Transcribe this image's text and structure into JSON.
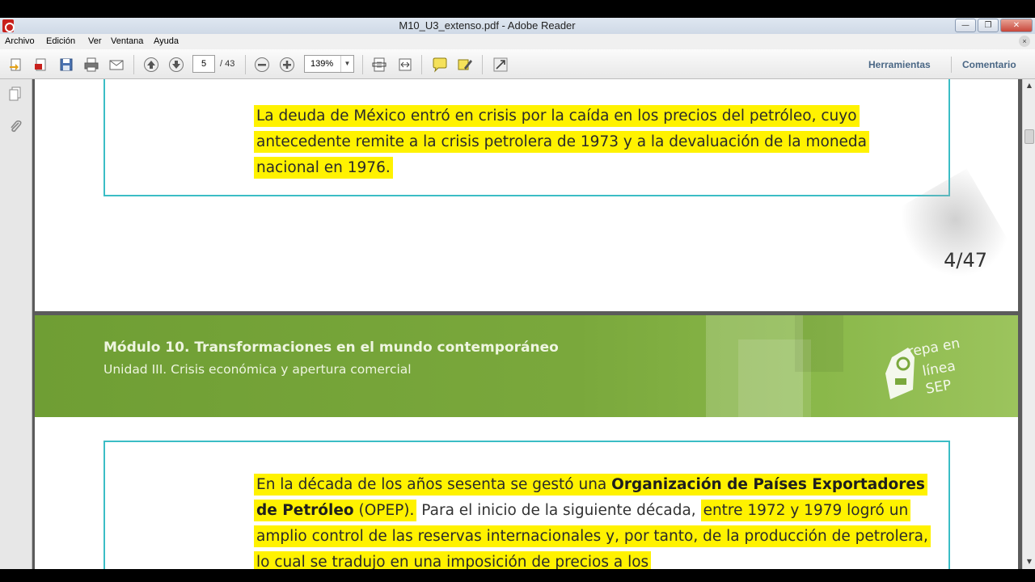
{
  "window": {
    "title": "M10_U3_extenso.pdf - Adobe Reader",
    "buttons": {
      "minimize": "—",
      "restore": "❐",
      "close": "✕"
    }
  },
  "menu": {
    "items": [
      "Archivo",
      "Edición",
      "Ver",
      "Ventana",
      "Ayuda"
    ],
    "close_doc": "×"
  },
  "toolbar": {
    "page_current": "5",
    "page_total": "/ 43",
    "zoom": "139%",
    "zoom_arrow": "▼",
    "tools_label": "Herramientas",
    "comment_label": "Comentario"
  },
  "document": {
    "page1": {
      "paragraph": "La deuda de México entró en crisis por la caída en los precios del petróleo, cuyo antecedente remite a la crisis petrolera de 1973 y a la devaluación de la moneda nacional en 1976.",
      "page_number": "4/47"
    },
    "page2": {
      "banner_title": "Módulo 10. Transformaciones en el mundo contemporáneo",
      "banner_subtitle": "Unidad III. Crisis económica  y apertura comercial",
      "logo_line1": "repa en",
      "logo_line2": "línea",
      "logo_line3": "SEP",
      "para_part1": "En la década de los años sesenta se gestó una",
      "para_bold": "Organización de Países Exportadores de Petróleo",
      "para_part2": "(OPEP).",
      "para_plain": "Para el inicio de la siguiente década,",
      "para_part3": "entre 1972 y 1979 logró un amplio control de las reservas internacionales y, por tanto, de la producción de petrolera, lo cual se tradujo en una imposición de precios a los"
    }
  },
  "colors": {
    "highlight": "#fff200",
    "box_border": "#3bbdc5",
    "banner_green": "#7aa83c"
  }
}
